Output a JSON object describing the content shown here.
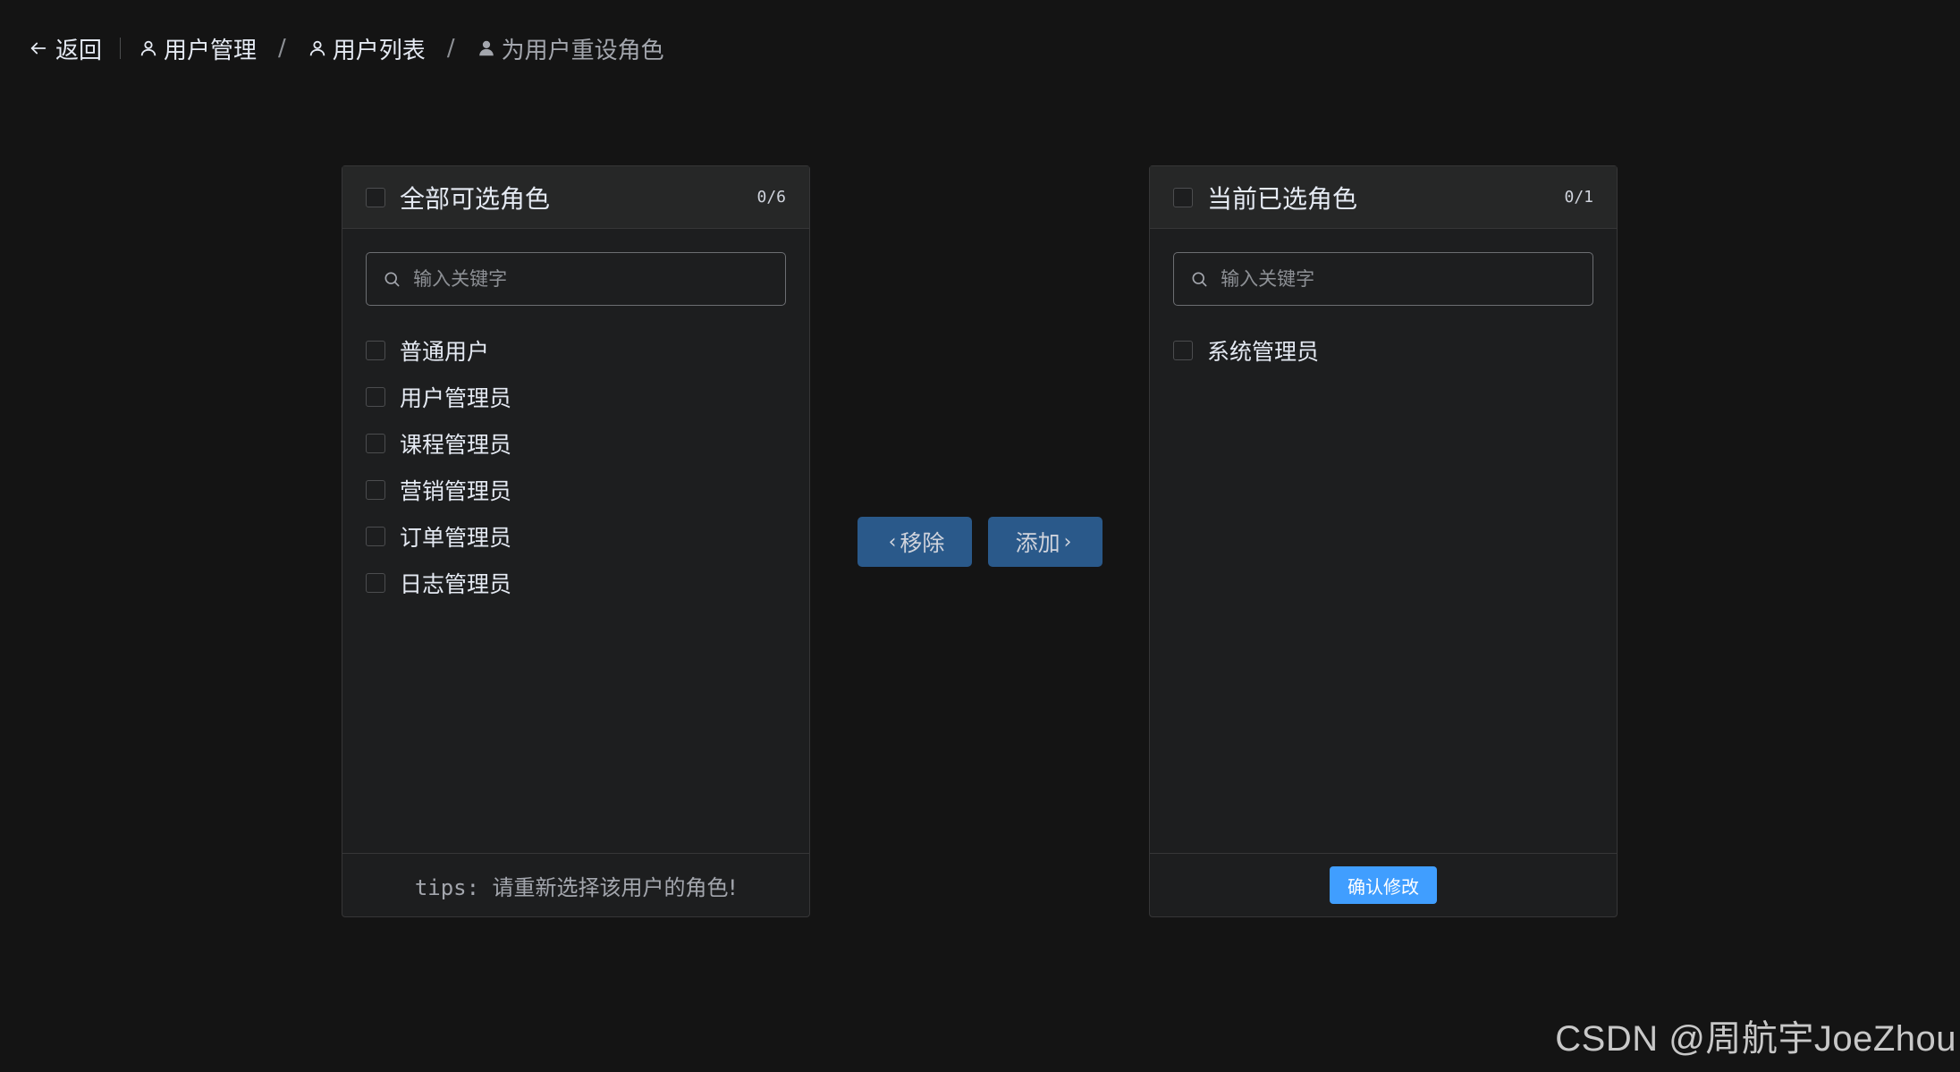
{
  "header": {
    "back_label": "返回",
    "breadcrumb": [
      "用户管理",
      "用户列表",
      "为用户重设角色"
    ],
    "separator": "/"
  },
  "left_panel": {
    "title": "全部可选角色",
    "count": "0/6",
    "search_placeholder": "输入关键字",
    "items": [
      "普通用户",
      "用户管理员",
      "课程管理员",
      "营销管理员",
      "订单管理员",
      "日志管理员"
    ],
    "footer_prefix": "tips: ",
    "footer_text": "请重新选择该用户的角色!"
  },
  "right_panel": {
    "title": "当前已选角色",
    "count": "0/1",
    "search_placeholder": "输入关键字",
    "items": [
      "系统管理员"
    ],
    "confirm_label": "确认修改"
  },
  "buttons": {
    "remove_label": "移除",
    "add_label": "添加"
  },
  "watermark": "CSDN @周航宇JoeZhou",
  "colors": {
    "background": "#141414",
    "panel": "#1d1e1f",
    "primary": "#409eff",
    "primary_disabled": "#2a598a"
  }
}
